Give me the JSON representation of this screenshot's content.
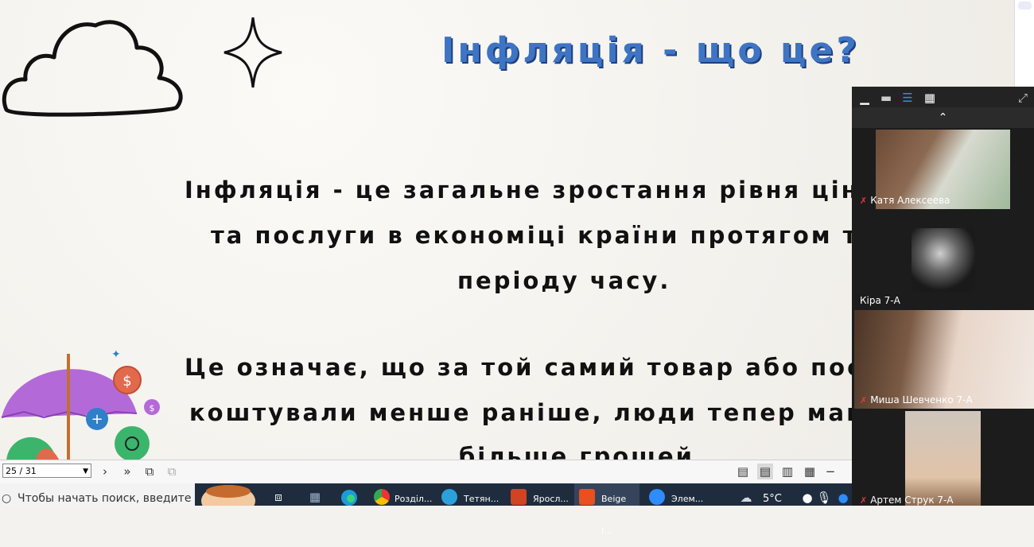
{
  "slide": {
    "title": "Інфляція - що це?",
    "paragraph1": [
      "Інфляція - це загальне зростання рівня цін на т",
      "та послуги в економіці країни протягом трива",
      "періоду часу."
    ],
    "paragraph2": [
      "Це означає, що за той самий товар або послуг",
      "коштували менше раніше, люди тепер мають пл",
      "більше грошей"
    ]
  },
  "viewer_toolbar": {
    "page_value": "25 / 31"
  },
  "video_panel": {
    "participants": [
      {
        "name": "Катя Алексеева",
        "muted": true
      },
      {
        "name": "Кіра 7-А",
        "muted": false
      },
      {
        "name": "Миша Шевченко 7-А",
        "muted": true
      },
      {
        "name": "Артем Струк 7-А",
        "muted": true
      }
    ]
  },
  "taskbar": {
    "search_placeholder": "Чтобы начать поиск, введите",
    "apps": [
      {
        "label": "Розділ...",
        "icon": "chrome-icon",
        "color": "#e9a23b"
      },
      {
        "label": "Тетян...",
        "icon": "telegram-icon",
        "color": "#2aa1da"
      },
      {
        "label": "Яросл...",
        "icon": "powerpoint-icon",
        "color": "#d04423"
      },
      {
        "label": "Beige I...",
        "icon": "wps-icon",
        "color": "#e8501f"
      },
      {
        "label": "Элем...",
        "icon": "zoom-icon",
        "color": "#2d8cff"
      }
    ],
    "temperature": "5°C"
  },
  "colors": {
    "title_blue": "#3e74c4",
    "title_shadow": "#1f3f7e",
    "taskbar_bg": "#1f2c3e",
    "panel_bg": "#1c1c1c"
  }
}
